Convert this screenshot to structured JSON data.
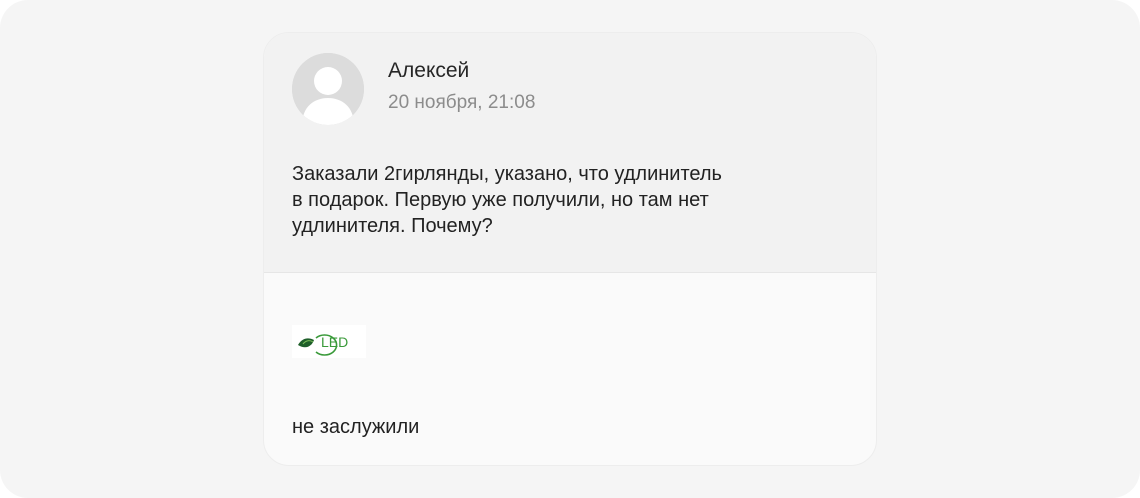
{
  "review": {
    "author": "Алексей",
    "date": "20 ноября, 21:08",
    "text_lines": [
      "Заказали 2гирлянды, указано, что удлинитель",
      "в подарок. Первую уже получили, но там нет",
      "удлинителя. Почему?"
    ],
    "avatar_icon": "default-user-avatar-icon"
  },
  "reply": {
    "logo_text": "LED",
    "logo_icon": "leaf-bulb-logo-icon",
    "text": "не заслужили"
  },
  "colors": {
    "page_background": "#f5f5f5",
    "review_background": "#f2f2f2",
    "reply_background": "#fafafa",
    "logo_green": "#3a9a3a",
    "logo_dark_green": "#1f5f2a"
  }
}
